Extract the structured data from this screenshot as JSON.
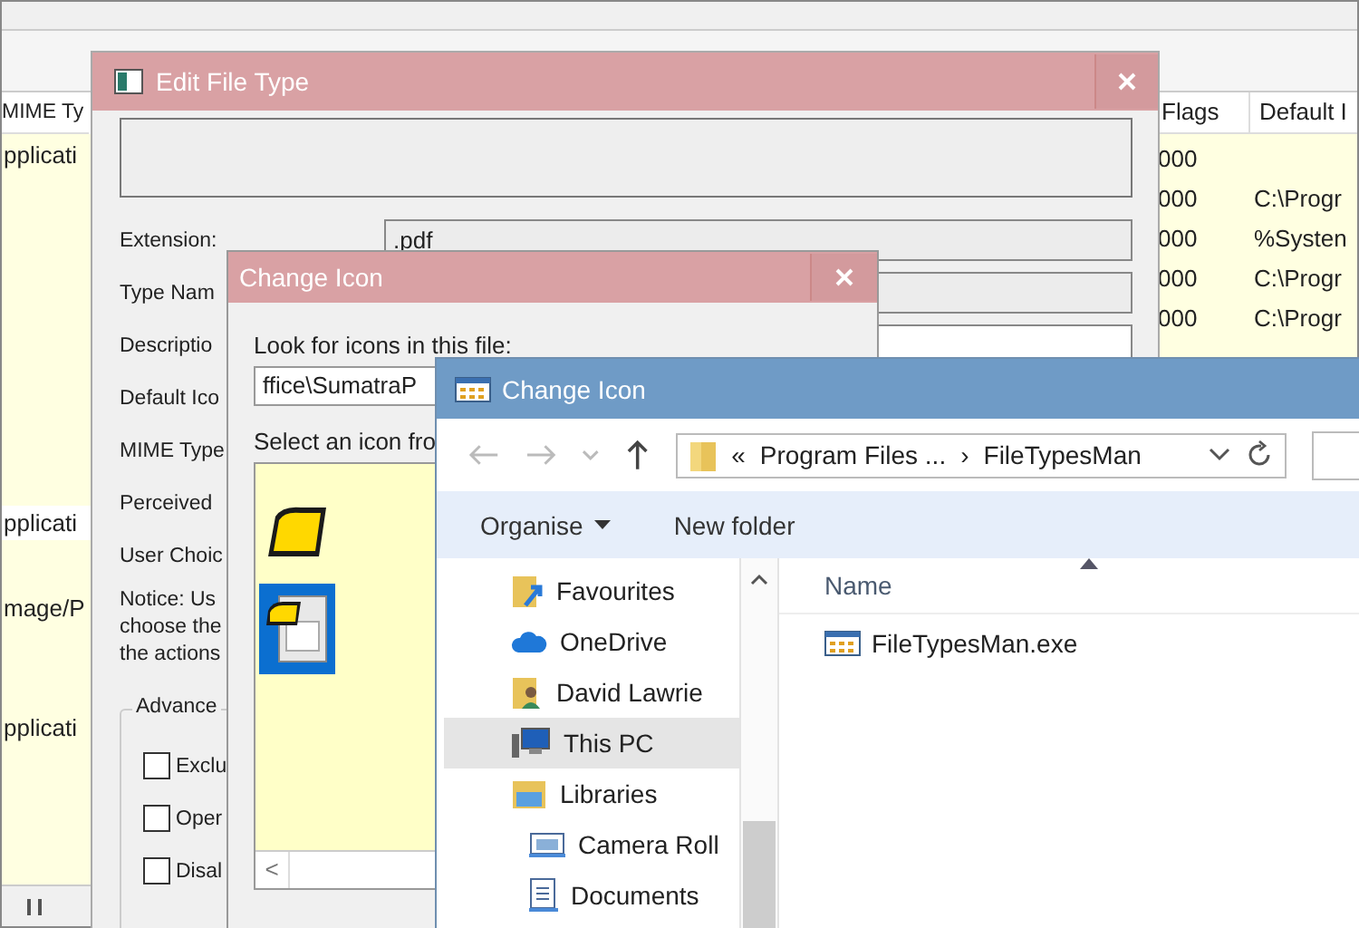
{
  "main_window": {
    "left_column": {
      "header": "MIME Ty",
      "rows": [
        {
          "text": "pplicati",
          "selected": false
        },
        {
          "text": "pplicati",
          "selected": true
        },
        {
          "text": "mage/P",
          "selected": false
        },
        {
          "text": "pplicati",
          "selected": false
        }
      ]
    },
    "right_columns": {
      "headers": [
        "Flags",
        "Default I"
      ],
      "rows": [
        [
          "000",
          ""
        ],
        [
          "000",
          "C:\\Progr"
        ],
        [
          "000",
          "%Systen"
        ],
        [
          "000",
          "C:\\Progr"
        ],
        [
          "000",
          "C:\\Progr"
        ]
      ]
    }
  },
  "edit_file_type": {
    "title": "Edit File Type",
    "rows": [
      {
        "label": "Extension:",
        "kind": "field",
        "value": ".pdf",
        "readonly": true
      },
      {
        "label": "Type Nam",
        "kind": "field",
        "readonly": true
      },
      {
        "label": "Descriptio",
        "kind": "field",
        "readonly": false
      },
      {
        "label": "Default Ico",
        "kind": "label"
      },
      {
        "label": "MIME Type",
        "kind": "label"
      },
      {
        "label": "Perceived",
        "kind": "label"
      },
      {
        "label": "User Choic",
        "kind": "label"
      }
    ],
    "notice": [
      "Notice: Us",
      "choose the",
      "the actions"
    ],
    "advanced": {
      "title": "Advance",
      "options": [
        {
          "label": "Exclu",
          "checked": false
        },
        {
          "label": "Oper",
          "checked": false
        },
        {
          "label": "Disal",
          "checked": false
        }
      ]
    }
  },
  "change_icon_classic": {
    "title": "Change Icon",
    "look_label": "Look for icons in this file:",
    "path": "ffice\\SumatraP",
    "select_label": "Select an icon fro",
    "icons": [
      {
        "kind": "badge",
        "selected": false
      },
      {
        "kind": "document",
        "selected": true
      }
    ],
    "scroll_left": "<"
  },
  "change_icon_explorer": {
    "title": "Change Icon",
    "address": [
      "«",
      "Program Files ...",
      "›",
      "FileTypesMan"
    ],
    "toolbar": [
      {
        "label": "Organise",
        "kind": "menu"
      },
      {
        "label": "New folder",
        "kind": "button"
      }
    ],
    "nav": [
      {
        "label": "Favourites",
        "selected": false
      },
      {
        "label": "OneDrive",
        "selected": false
      },
      {
        "label": "David Lawrie",
        "selected": false
      },
      {
        "label": "This PC",
        "selected": true
      },
      {
        "label": "Libraries",
        "selected": false,
        "children": [
          {
            "label": "Camera Roll",
            "selected": false
          },
          {
            "label": "Documents",
            "selected": false
          }
        ]
      }
    ],
    "column": "Name",
    "files": [
      "FileTypesMan.exe"
    ]
  }
}
